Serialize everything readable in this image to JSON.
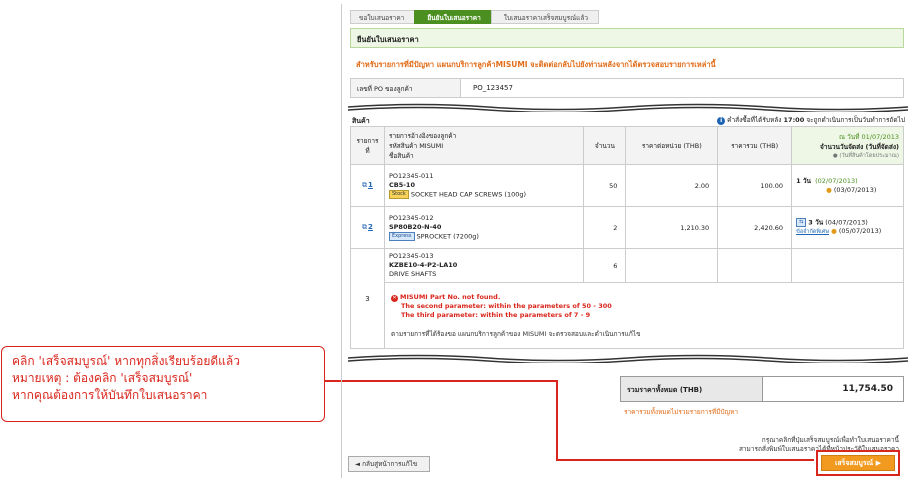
{
  "callout": {
    "line1": "คลิก 'เสร็จสมบูรณ์' หากทุกสิ่งเรียบร้อยดีแล้ว",
    "line2": "หมายเหตุ : ต้องคลิก 'เสร็จสมบูรณ์'",
    "line3": "หากคุณต้องการให้บันทึกใบเสนอราคา"
  },
  "steps": [
    "ขอใบเสนอราคา",
    "ยืนยันใบเสนอราคา",
    "ใบเสนอราคาเสร็จสมบูรณ์แล้ว"
  ],
  "header_title": "ยืนยันใบเสนอราคา",
  "notice": "สำหรับรายการที่มีปัญหา แผนกบริการลูกค้าMISUMI จะติดต่อกลับไปยังท่านหลังจากได้ตรวจสอบรายการเหล่านี้",
  "po": {
    "label": "เลขที่ PO ของลูกค้า",
    "value": "PO_123457"
  },
  "products_label": "สินค้า",
  "cutoff": {
    "prefix": "คำสั่งซื้อที่ได้รับหลัง",
    "time": "17:00",
    "suffix": "จะถูกดำเนินการเป็นวันทำการถัดไป"
  },
  "columns": {
    "item": "รายการที่",
    "desc1": "รายการอ้างอิงของลูกค้า",
    "desc2": "รหัสสินค้า MISUMI",
    "desc3": "ชื่อสินค้า",
    "qty": "จำนวน",
    "unit_price": "ราคาต่อหน่วย (THB)",
    "total": "ราคารวม (THB)",
    "ship_date": "ณ วันที่ 01/07/2013",
    "ship_days": "จำนวนวันจัดส่ง (วันที่จัดส่ง)",
    "ship_note": "● (วันที่สินค้าโดยประมาณ)"
  },
  "rows": [
    {
      "no": "1",
      "ref": "PO12345-011",
      "code": "CB5-10",
      "badge": "Stock",
      "name": "SOCKET HEAD CAP SCREWS (100g)",
      "qty": "50",
      "unit": "2.00",
      "total": "100.00",
      "days": "1 วัน",
      "d1": "(02/07/2013)",
      "d2": "(03/07/2013)"
    },
    {
      "no": "2",
      "ref": "PO12345-012",
      "code": "SP80B20-N-40",
      "badge": "Express",
      "name": "SPROCKET (7200g)",
      "qty": "2",
      "unit": "1,210.30",
      "total": "2,420.60",
      "days": "3 วัน",
      "d1": "(04/07/2013)",
      "d2": "(05/07/2013)",
      "ship_link": "ข้อจำกัดพิเศษ"
    },
    {
      "no": "3",
      "ref": "PO12345-013",
      "code": "KZBE10-4-P2-LA10",
      "name": "DRIVE SHAFTS",
      "qty": "6"
    }
  ],
  "error": {
    "title": "MISUMI Part No. not found.",
    "line1": "The second parameter: within the parameters of 50 - 300",
    "line2": "The third parameter: within the parameters of 7 - 9",
    "note": "ตามรายการที่ได้ร้องขอ แผนกบริการลูกค้าของ MISUMI จะตรวจสอบและดำเนินการแก้ไข"
  },
  "total": {
    "label": "รวมราคาทั้งหมด (THB)",
    "value": "11,754.50",
    "note": "ราคารวมทั้งหมดไม่รวมรายการที่มีปัญหา"
  },
  "footer": {
    "line1": "กรุณาคลิกที่ปุ่มเสร็จสมบูรณ์เพื่อทำใบเสนอราคานี้",
    "line2": "สามารถสั่งพิมพ์ใบเสนอราคาได้ที่หน้าประวัติใบเสนอราคา"
  },
  "buttons": {
    "back": "◄ กลับสู่หน้าการแก้ไข",
    "finish": "เสร็จสมบูรณ์"
  },
  "colors": {
    "accent_red": "#d9261c",
    "brand_green": "#4a8f1f",
    "orange": "#f29a1f"
  }
}
